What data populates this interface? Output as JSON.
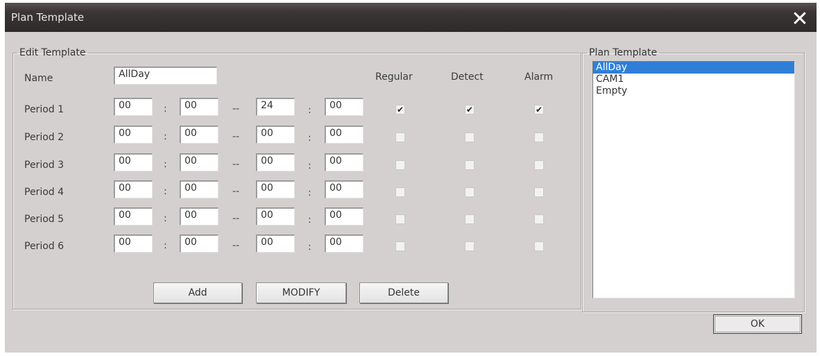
{
  "window": {
    "title": "Plan Template"
  },
  "edit_template": {
    "legend": "Edit Template",
    "name_label": "Name",
    "name_value": "AllDay",
    "columns": {
      "regular": "Regular",
      "detect": "Detect",
      "alarm": "Alarm"
    },
    "periods": [
      {
        "label": "Period 1",
        "start_h": "00",
        "start_m": "00",
        "end_h": "24",
        "end_m": "00",
        "regular": true,
        "detect": true,
        "alarm": true
      },
      {
        "label": "Period 2",
        "start_h": "00",
        "start_m": "00",
        "end_h": "00",
        "end_m": "00",
        "regular": false,
        "detect": false,
        "alarm": false
      },
      {
        "label": "Period 3",
        "start_h": "00",
        "start_m": "00",
        "end_h": "00",
        "end_m": "00",
        "regular": false,
        "detect": false,
        "alarm": false
      },
      {
        "label": "Period 4",
        "start_h": "00",
        "start_m": "00",
        "end_h": "00",
        "end_m": "00",
        "regular": false,
        "detect": false,
        "alarm": false
      },
      {
        "label": "Period 5",
        "start_h": "00",
        "start_m": "00",
        "end_h": "00",
        "end_m": "00",
        "regular": false,
        "detect": false,
        "alarm": false
      },
      {
        "label": "Period 6",
        "start_h": "00",
        "start_m": "00",
        "end_h": "00",
        "end_m": "00",
        "regular": false,
        "detect": false,
        "alarm": false
      }
    ],
    "time_colon": ":",
    "range_dash": "--",
    "buttons": {
      "add": "Add",
      "modify": "MODIFY",
      "delete": "Delete"
    }
  },
  "plan_template": {
    "legend": "Plan Template",
    "items": [
      "AllDay",
      "CAM1",
      "Empty"
    ],
    "selected_index": 0
  },
  "ok_label": "OK",
  "icons": {
    "close": "close-icon",
    "check": "checkmark-icon"
  }
}
